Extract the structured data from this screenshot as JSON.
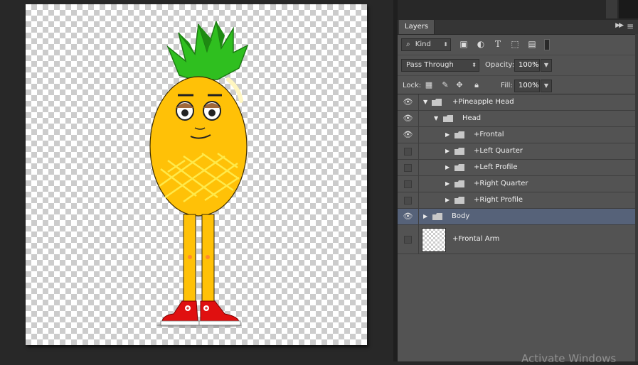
{
  "canvas": {
    "art_name": "pineapple character"
  },
  "panel": {
    "tab_label": "Layers",
    "filter": {
      "label": "Kind",
      "search_icon": "search-icon"
    },
    "filter_icons": [
      "image-filter-icon",
      "adjustment-filter-icon",
      "type-filter-icon",
      "shape-filter-icon",
      "smart-object-filter-icon"
    ],
    "blend_mode": "Pass Through",
    "opacity_label": "Opacity:",
    "opacity_value": "100%",
    "lock_label": "Lock:",
    "lock_icons": [
      "lock-transparent-icon",
      "lock-paint-icon",
      "lock-position-icon",
      "lock-all-icon"
    ],
    "fill_label": "Fill:",
    "fill_value": "100%"
  },
  "layers": [
    {
      "name": "+Pineapple Head",
      "visible": true,
      "expanded": true,
      "indent": 0,
      "selected": false
    },
    {
      "name": "Head",
      "visible": true,
      "expanded": true,
      "indent": 1,
      "selected": false
    },
    {
      "name": "+Frontal",
      "visible": true,
      "expanded": false,
      "indent": 2,
      "selected": false
    },
    {
      "name": "+Left Quarter",
      "visible": false,
      "expanded": false,
      "indent": 2,
      "selected": false
    },
    {
      "name": "+Left Profile",
      "visible": false,
      "expanded": false,
      "indent": 2,
      "selected": false
    },
    {
      "name": "+Right Quarter",
      "visible": false,
      "expanded": false,
      "indent": 2,
      "selected": false
    },
    {
      "name": "+Right Profile",
      "visible": false,
      "expanded": false,
      "indent": 2,
      "selected": false
    },
    {
      "name": "Body",
      "visible": true,
      "expanded": false,
      "indent": 0,
      "selected": true
    },
    {
      "name": "+Frontal Arm",
      "visible": false,
      "is_layer": true,
      "selected": false
    }
  ],
  "watermark": "Activate Windows",
  "colors": {
    "panel_bg": "#535353",
    "selected_row": "#566279",
    "workspace_bg": "#282828"
  }
}
